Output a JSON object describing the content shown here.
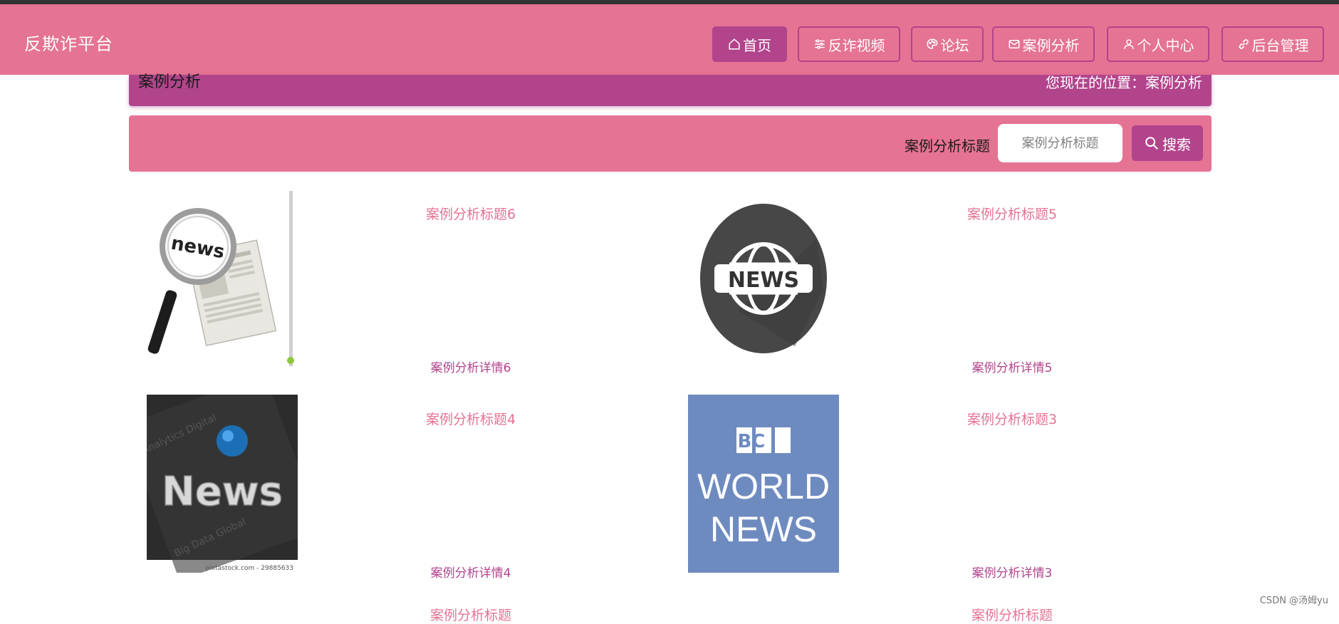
{
  "brand": "反欺诈平台",
  "nav": [
    {
      "label": "首页",
      "icon": "home-icon",
      "active": true
    },
    {
      "label": "反诈视频",
      "icon": "sliders-icon"
    },
    {
      "label": "论坛",
      "icon": "palette-icon"
    },
    {
      "label": "案例分析",
      "icon": "mail-icon"
    },
    {
      "label": "个人中心",
      "icon": "person-icon"
    },
    {
      "label": "后台管理",
      "icon": "link-icon"
    }
  ],
  "breadcrumb": {
    "title": "案例分析",
    "position": "您现在的位置：案例分析"
  },
  "search": {
    "label": "案例分析标题",
    "placeholder": "案例分析标题",
    "button": "搜索"
  },
  "items": [
    {
      "title": "案例分析标题6",
      "detail": "案例分析详情6",
      "image": "newspaper-magnifier-image",
      "image_text": "news"
    },
    {
      "title": "案例分析标题5",
      "detail": "案例分析详情5",
      "image": "news-globe-badge-image",
      "image_text": "NEWS"
    },
    {
      "title": "案例分析标题4",
      "detail": "案例分析详情4",
      "image": "news-3d-text-image",
      "image_text": "News",
      "image_caption": "pixtastock.com - 29885633"
    },
    {
      "title": "案例分析标题3",
      "detail": "案例分析详情3",
      "image": "bbc-world-news-logo-image",
      "image_lines": [
        "BBC",
        "WORLD",
        "NEWS"
      ]
    }
  ],
  "partial_titles": [
    "案例分析标题",
    "案例分析标题"
  ],
  "watermark": "CSDN @汤姆yu",
  "colors": {
    "primary": "#e57393",
    "accent": "#b2448c",
    "topline": "#333333"
  }
}
